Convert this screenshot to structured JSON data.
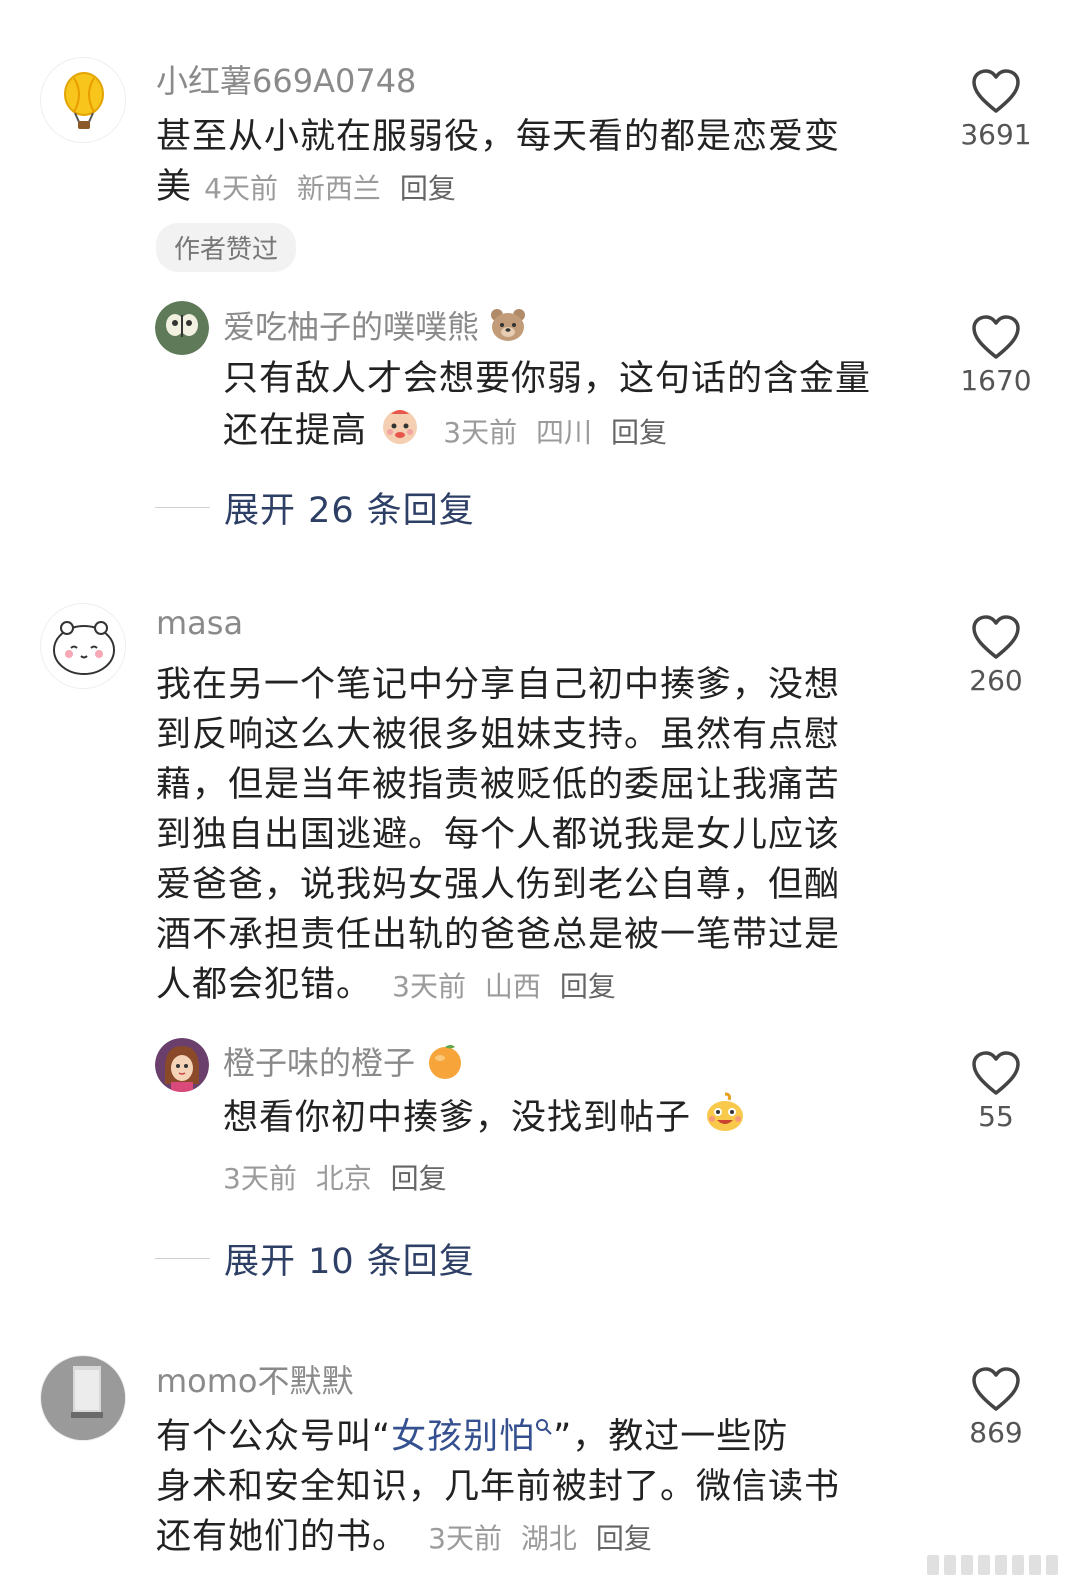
{
  "comments": [
    {
      "username": "小红薯669A0748",
      "text": "甚至从小就在服弱役，每天看的都是恋爱变美",
      "line1": "甚至从小就在服弱役，每天看的都是恋爱变",
      "line2": "美",
      "time": "4天前",
      "location": "新西兰",
      "reply_label": "回复",
      "likes": "3691",
      "badge": "作者赞过",
      "avatar_icon": "hot-air-balloon-icon",
      "reply": {
        "username": "爱吃柚子的噗噗熊",
        "line1": "只有敌人才会想要你弱，这句话的含金量",
        "line2": "还在提高",
        "time": "3天前",
        "location": "四川",
        "reply_label": "回复",
        "likes": "1670"
      },
      "expand_label": "展开 26 条回复"
    },
    {
      "username": "masa",
      "lines": [
        "我在另一个笔记中分享自己初中揍爹，没想",
        "到反响这么大被很多姐妹支持。虽然有点慰",
        "藉，但是当年被指责被贬低的委屈让我痛苦",
        "到独自出国逃避。每个人都说我是女儿应该",
        "爱爸爸，说我妈女强人伤到老公自尊，但酗",
        "酒不承担责任出轨的爸爸总是被一笔带过是",
        "人都会犯错。"
      ],
      "time": "3天前",
      "location": "山西",
      "reply_label": "回复",
      "likes": "260",
      "reply": {
        "username": "橙子味的橙子",
        "line1": "想看你初中揍爹，没找到帖子",
        "time": "3天前",
        "location": "北京",
        "reply_label": "回复",
        "likes": "55"
      },
      "expand_label": "展开 10 条回复"
    },
    {
      "username": "momo不默默",
      "line1_pre": "有个公众号叫“",
      "line1_link": "女孩别怕",
      "line1_post": "”，教过一些防",
      "line2": "身术和安全知识，几年前被封了。微信读书",
      "line3": "还有她们的书。",
      "time": "3天前",
      "location": "湖北",
      "reply_label": "回复",
      "likes": "869"
    }
  ],
  "colors": {
    "username": "#8a8a8a",
    "expand_link": "#2e3f66",
    "keyword_link": "#35508f"
  }
}
